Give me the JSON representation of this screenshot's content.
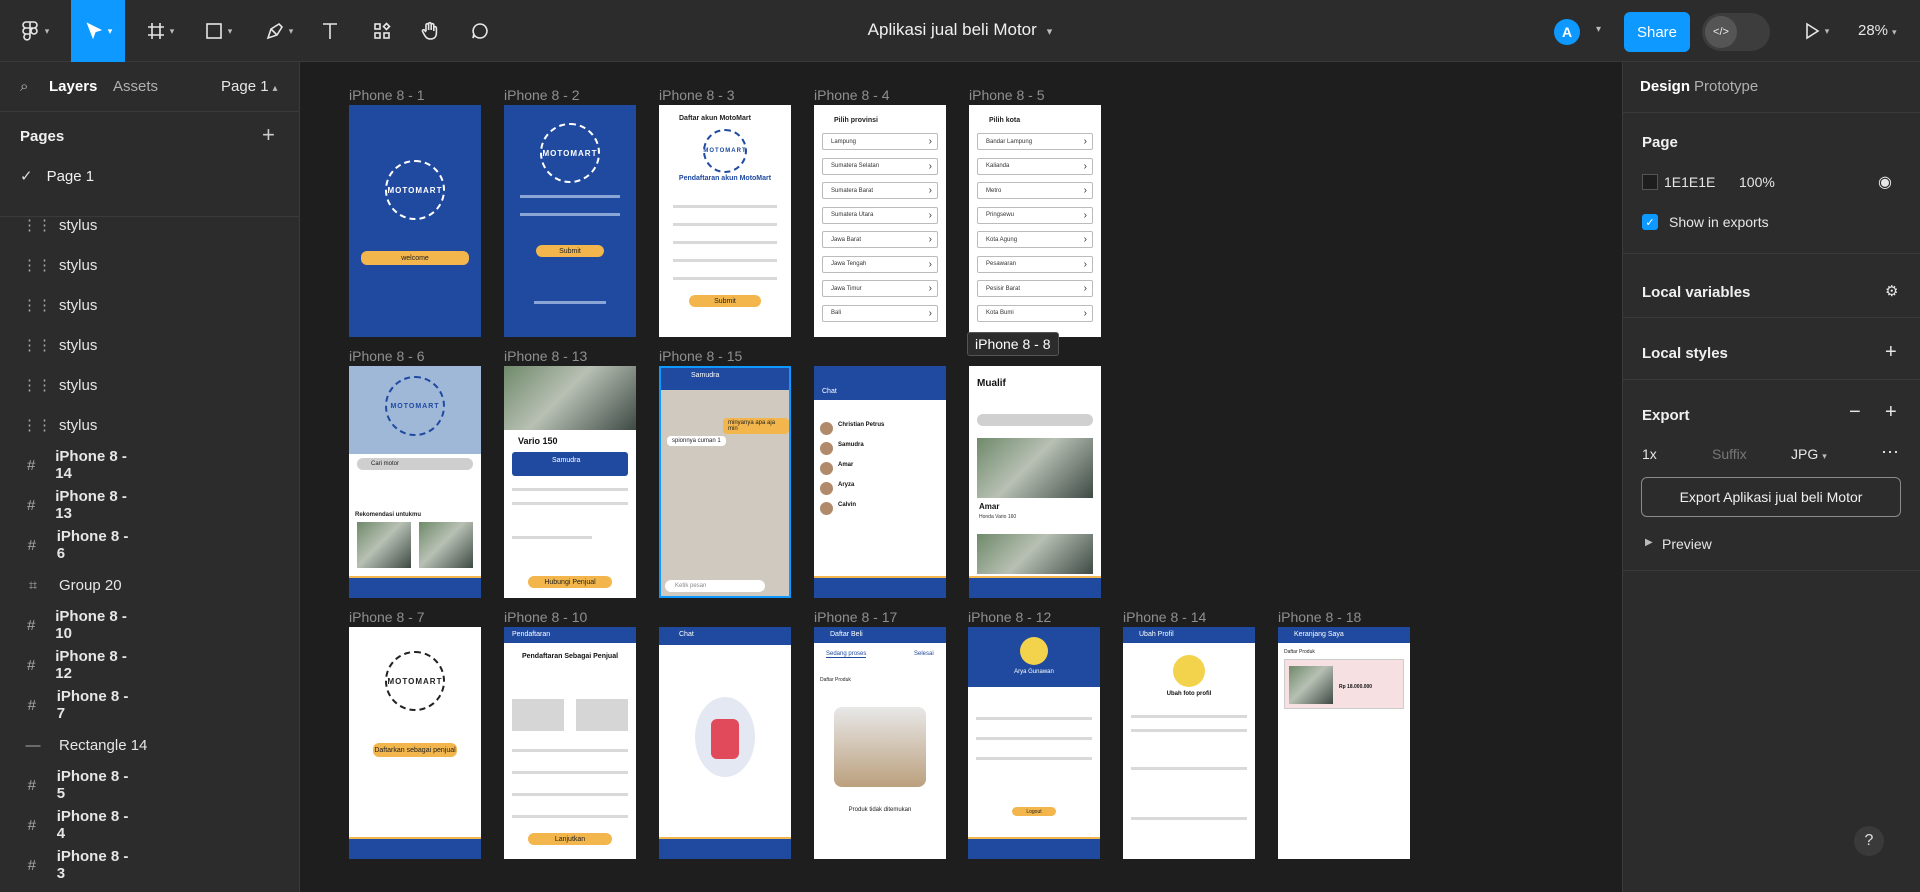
{
  "toolbar": {
    "document_title": "Aplikasi jual beli Motor",
    "avatar_initial": "A",
    "share_label": "Share",
    "zoom": "28%",
    "devmode_label": "</>"
  },
  "left_panel": {
    "tabs": [
      "Layers",
      "Assets"
    ],
    "page_selector": "Page 1",
    "pages_heading": "Pages",
    "pages": [
      "Page 1"
    ],
    "layers": [
      {
        "name": "stylus",
        "type": "grid"
      },
      {
        "name": "stylus",
        "type": "grid"
      },
      {
        "name": "stylus",
        "type": "grid"
      },
      {
        "name": "stylus",
        "type": "grid"
      },
      {
        "name": "stylus",
        "type": "grid"
      },
      {
        "name": "stylus",
        "type": "grid"
      },
      {
        "name": "iPhone 8 - 14",
        "type": "frame"
      },
      {
        "name": "iPhone 8 - 13",
        "type": "frame"
      },
      {
        "name": "iPhone 8 - 6",
        "type": "frame"
      },
      {
        "name": "Group 20",
        "type": "group"
      },
      {
        "name": "iPhone 8 - 10",
        "type": "frame"
      },
      {
        "name": "iPhone 8 - 12",
        "type": "frame"
      },
      {
        "name": "iPhone 8 - 7",
        "type": "frame"
      },
      {
        "name": "Rectangle 14",
        "type": "rect"
      },
      {
        "name": "iPhone 8 - 5",
        "type": "frame"
      },
      {
        "name": "iPhone 8 - 4",
        "type": "frame"
      },
      {
        "name": "iPhone 8 - 3",
        "type": "frame"
      }
    ]
  },
  "canvas": {
    "frame_labels": {
      "f1": "iPhone 8 - 1",
      "f2": "iPhone 8 - 2",
      "f3": "iPhone 8 - 3",
      "f4": "iPhone 8 - 4",
      "f5": "iPhone 8 - 5",
      "f6": "iPhone 8 - 6",
      "f13": "iPhone 8 - 13",
      "f15": "iPhone 8 - 15",
      "f8": "iPhone 8 - 8",
      "f7": "iPhone 8 - 7",
      "f10": "iPhone 8 - 10",
      "f17": "iPhone 8 - 17",
      "f12": "iPhone 8 - 12",
      "f14": "iPhone 8 - 14",
      "f18": "iPhone 8 - 18"
    },
    "welcome_btn": "welcome",
    "submit_btn": "Submit",
    "daftar_akun": "Daftar akun MotoMart",
    "pendaftaran_akun": "Pendaftaran akun MotoMart",
    "pilih_provinsi": "Pilih provinsi",
    "provinsi": [
      "Lampung",
      "Sumatera Selatan",
      "Sumatera Barat",
      "Sumatera Utara",
      "Jawa Barat",
      "Jawa Tengah",
      "Jawa Timur",
      "Bali"
    ],
    "pilih_kota": "Pilih kota",
    "kota": [
      "Bandar Lampung",
      "Kalianda",
      "Metro",
      "Pringsewu",
      "Kota Agung",
      "Pesawaran",
      "Pesisir Barat",
      "Kota Bumi"
    ],
    "cari_motor": "Cari motor",
    "rekomendasi": "Rekomendasi untukmu",
    "vario": "Vario 150",
    "samudra": "Samudra",
    "hubungi_penjual": "Hubungi Penjual",
    "chat_bubble_1": "minyanya apa aja min",
    "chat_bubble_2": "spionnya cuman 1",
    "ketik_pesan": "Ketik pesan",
    "chat_title": "Chat",
    "chat_names": [
      "Christian Petrus",
      "Samudra",
      "Amar",
      "Aryza",
      "Calvin"
    ],
    "mualif": "Mualif",
    "amar": "Amar",
    "honda_vario": "Honda Vario 160",
    "daftarkan": "Daftarkan sebagai penjual",
    "pendaftaran": "Pendaftaran",
    "pendaftaran_penjual": "Pendaftaran Sebagai Penjual",
    "lanjutkan": "Lanjutkan",
    "daftar_beli": "Daftar Beli",
    "sedang_proses": "Sedang proses",
    "selesai": "Selesai",
    "daftar_produk": "Daftar Produk",
    "produk_kosong": "Produk tidak ditemukan",
    "profile_name": "Arya Gunawan",
    "logout": "Logout",
    "ubah_profil": "Ubah Profil",
    "ubah_foto": "Ubah foto profil",
    "keranjang": "Keranjang Saya",
    "harga": "Rp 18.000.000"
  },
  "right_panel": {
    "tabs": [
      "Design",
      "Prototype"
    ],
    "page_heading": "Page",
    "page_color": "1E1E1E",
    "page_opacity": "100%",
    "show_in_exports": "Show in exports",
    "local_variables": "Local variables",
    "local_styles": "Local styles",
    "export_heading": "Export",
    "export_scale": "1x",
    "export_suffix_placeholder": "Suffix",
    "export_format": "JPG",
    "export_button": "Export Aplikasi jual beli Motor",
    "preview": "Preview"
  },
  "colors": {
    "accent": "#0d99ff",
    "panel": "#2c2c2c",
    "canvas": "#1e1e1e",
    "app_blue": "#1f4aa0",
    "app_yellow": "#f3b64c"
  }
}
